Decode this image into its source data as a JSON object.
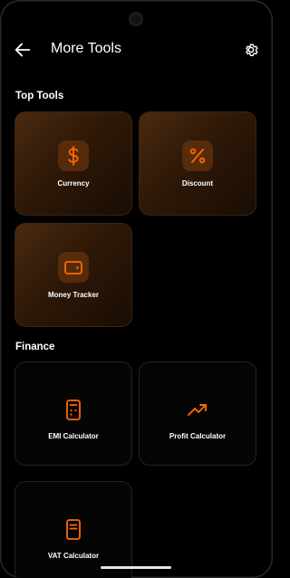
{
  "header": {
    "title": "More Tools"
  },
  "sections": {
    "top": {
      "title": "Top Tools",
      "items": [
        {
          "label": "Currency",
          "icon": "dollar-icon"
        },
        {
          "label": "Discount",
          "icon": "percent-icon"
        },
        {
          "label": "Money Tracker",
          "icon": "wallet-icon"
        }
      ]
    },
    "finance": {
      "title": "Finance",
      "items": [
        {
          "label": "EMI Calculator",
          "icon": "calculator-icon"
        },
        {
          "label": "Profit Calculator",
          "icon": "trending-up-icon"
        },
        {
          "label": "VAT Calculator",
          "icon": "receipt-icon"
        }
      ]
    }
  },
  "colors": {
    "accent": "#FF6A00",
    "background": "#000000"
  }
}
